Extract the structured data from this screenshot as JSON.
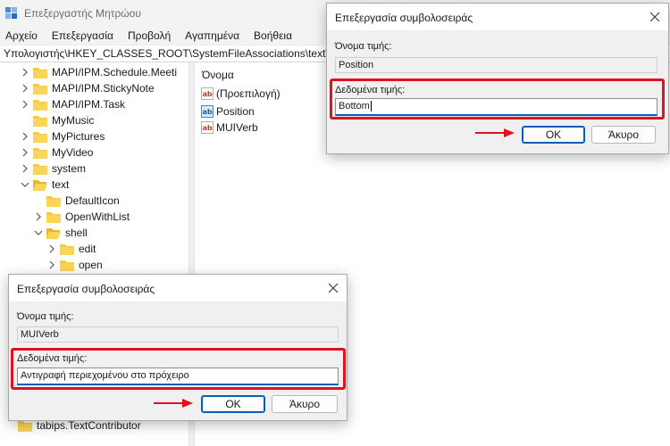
{
  "window": {
    "title": "Επεξεργαστής Μητρώου",
    "address": "Υπολογιστής\\HKEY_CLASSES_ROOT\\SystemFileAssociations\\text\\she"
  },
  "menu": [
    "Αρχείο",
    "Επεξεργασία",
    "Προβολή",
    "Αγαπημένα",
    "Βοήθεια"
  ],
  "tree": [
    {
      "label": "MAPI/IPM.Schedule.Meeti",
      "expander": "collapsed"
    },
    {
      "label": "MAPI/IPM.StickyNote",
      "expander": "collapsed"
    },
    {
      "label": "MAPI/IPM.Task",
      "expander": "collapsed"
    },
    {
      "label": "MyMusic",
      "expander": "none"
    },
    {
      "label": "MyPictures",
      "expander": "collapsed"
    },
    {
      "label": "MyVideo",
      "expander": "collapsed"
    },
    {
      "label": "system",
      "expander": "collapsed"
    },
    {
      "label": "text",
      "expander": "expanded"
    },
    {
      "label": "DefaultIcon",
      "expander": "none"
    },
    {
      "label": "OpenWithList",
      "expander": "collapsed"
    },
    {
      "label": "shell",
      "expander": "expanded"
    },
    {
      "label": "edit",
      "expander": "collapsed"
    },
    {
      "label": "open",
      "expander": "collapsed"
    },
    {
      "label": "tabips.TextContributor",
      "expander": "none"
    }
  ],
  "list": {
    "column_name": "Όνομα",
    "values": [
      {
        "name": "(Προεπιλογή)",
        "icon": "string-value-icon"
      },
      {
        "name": "Position",
        "icon": "binary-value-icon"
      },
      {
        "name": "MUIVerb",
        "icon": "string-value-icon"
      }
    ]
  },
  "dialog_top": {
    "title": "Επεξεργασία συμβολοσειράς",
    "name_label": "Όνομα τιμής:",
    "name_value": "Position",
    "data_label": "Δεδομένα τιμής:",
    "data_value": "Bottom",
    "ok_label": "OK",
    "cancel_label": "Άκυρο"
  },
  "dialog_bottom": {
    "title": "Επεξεργασία συμβολοσειράς",
    "name_label": "Όνομα τιμής:",
    "name_value": "MUIVerb",
    "data_label": "Δεδομένα τιμής:",
    "data_value": "Αντιγραφή περιεχομένου στο πρόχειρο",
    "ok_label": "OK",
    "cancel_label": "Άκυρο"
  },
  "colors": {
    "accent": "#005fb8",
    "highlight_red": "#e0121f",
    "folder_yellow": "#f8c93f"
  }
}
